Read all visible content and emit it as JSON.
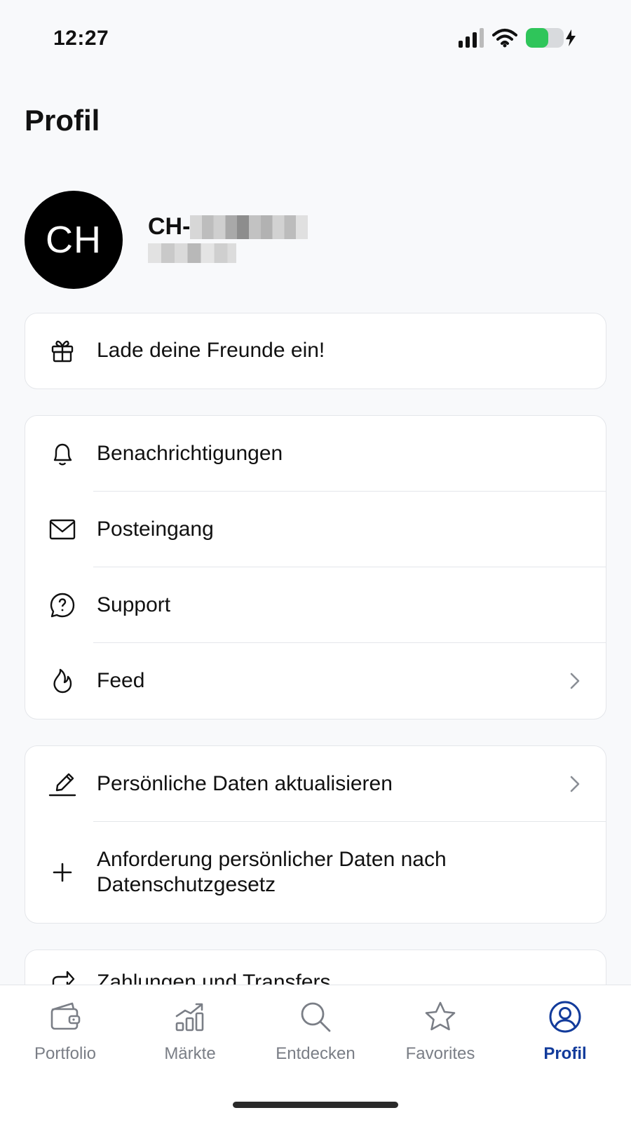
{
  "status_bar": {
    "time": "12:27",
    "battery_level": 0.6
  },
  "page": {
    "title": "Profil"
  },
  "profile": {
    "initials": "CH",
    "name_prefix": "CH-"
  },
  "invite": {
    "label": "Lade deine Freunde ein!",
    "icon": "gift-icon"
  },
  "menu_group_1": [
    {
      "label": "Benachrichtigungen",
      "icon": "bell-icon",
      "chevron": false
    },
    {
      "label": "Posteingang",
      "icon": "mail-icon",
      "chevron": false
    },
    {
      "label": "Support",
      "icon": "help-bubble-icon",
      "chevron": false
    },
    {
      "label": "Feed",
      "icon": "flame-icon",
      "chevron": true
    }
  ],
  "menu_group_2": [
    {
      "label": "Persönliche Daten aktualisieren",
      "icon": "pencil-icon",
      "chevron": true
    },
    {
      "label": "Anforderung persönlicher Daten nach Datenschutzgesetz",
      "icon": "plus-icon",
      "chevron": false
    }
  ],
  "menu_group_3": [
    {
      "label": "Zahlungen und Transfers",
      "icon": "transfer-icon"
    }
  ],
  "tab_bar": {
    "active": "Profil",
    "accent": "#123b9b",
    "tabs": [
      {
        "label": "Portfolio",
        "icon": "wallet-icon"
      },
      {
        "label": "Märkte",
        "icon": "chart-icon"
      },
      {
        "label": "Entdecken",
        "icon": "search-icon"
      },
      {
        "label": "Favorites",
        "icon": "star-icon"
      },
      {
        "label": "Profil",
        "icon": "user-circle-icon"
      }
    ]
  }
}
